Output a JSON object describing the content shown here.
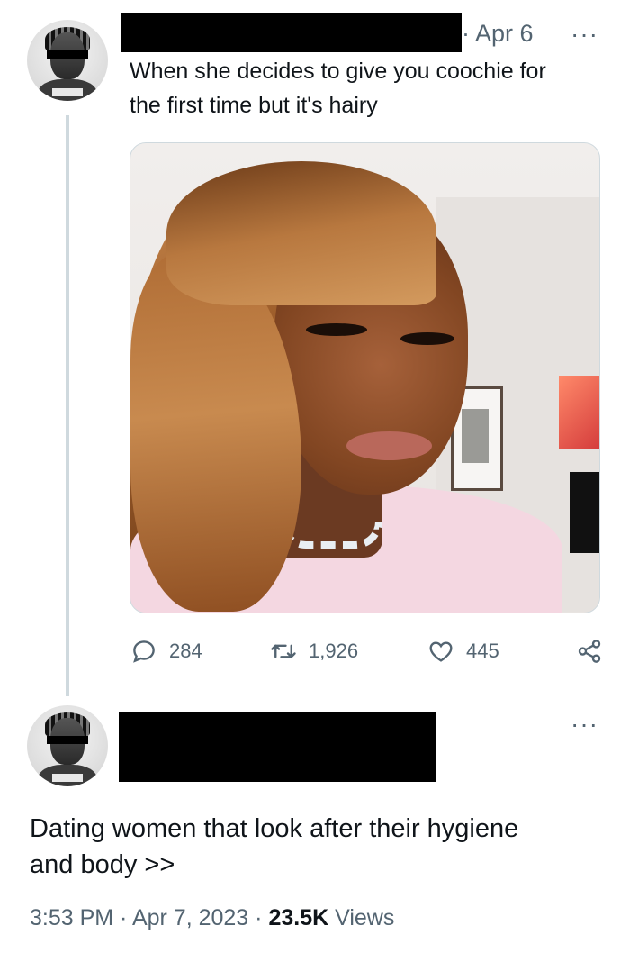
{
  "first_tweet": {
    "date": "· Apr 6",
    "more": "···",
    "text_line1": "When she decides to give you coochie for",
    "text_line2": "the first time but it's hairy",
    "actions": {
      "replies": "284",
      "retweets": "1,926",
      "likes": "445"
    },
    "icons": {
      "reply": "reply-icon",
      "retweet": "retweet-icon",
      "like": "heart-icon",
      "share": "share-icon"
    }
  },
  "second_tweet": {
    "more": "···",
    "text_line1": "Dating women that look after their hygiene",
    "text_line2": "and body >>",
    "time": "3:53 PM",
    "sep1": " · ",
    "date": "Apr 7, 2023",
    "sep2": " · ",
    "views_count": "23.5K",
    "views_label": " Views"
  }
}
